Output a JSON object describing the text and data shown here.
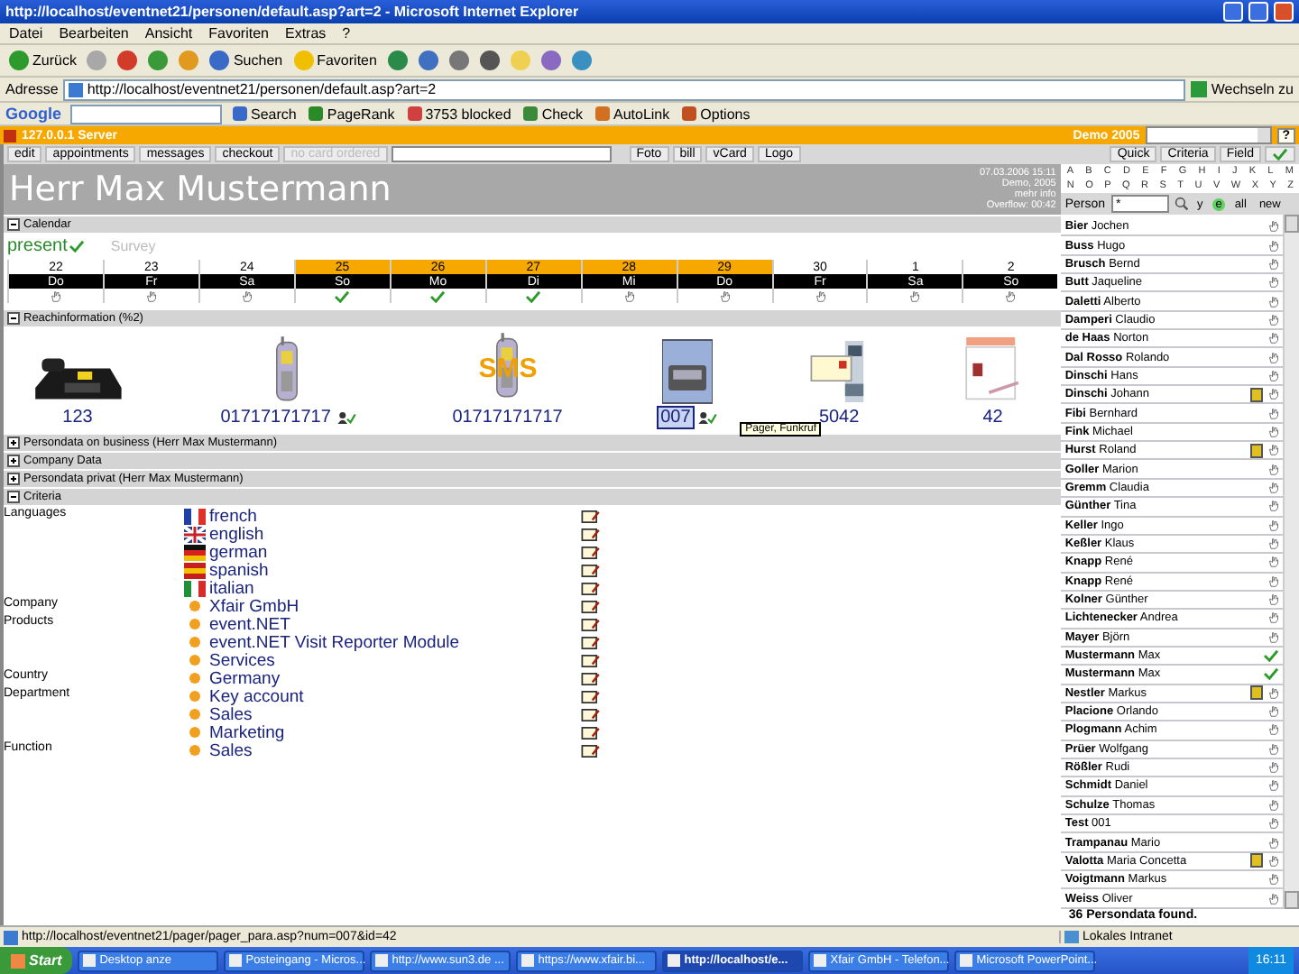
{
  "browser": {
    "title": "http://localhost/eventnet21/personen/default.asp?art=2 - Microsoft Internet Explorer",
    "menu": [
      "Datei",
      "Bearbeiten",
      "Ansicht",
      "Favoriten",
      "Extras",
      "?"
    ],
    "toolbar": [
      {
        "kind": "back",
        "label": "Zurück"
      },
      {
        "kind": "forward"
      },
      {
        "kind": "stop"
      },
      {
        "kind": "refresh"
      },
      {
        "kind": "home"
      },
      {
        "kind": "search",
        "label": "Suchen"
      },
      {
        "kind": "favorites",
        "label": "Favoriten"
      },
      {
        "kind": "history"
      },
      {
        "kind": "mail"
      },
      {
        "kind": "print"
      },
      {
        "kind": "edit"
      },
      {
        "kind": "folder"
      },
      {
        "kind": "research"
      },
      {
        "kind": "messenger"
      }
    ],
    "address": {
      "label": "Adresse",
      "value": "http://localhost/eventnet21/personen/default.asp?art=2",
      "go": "Wechseln zu"
    },
    "google": {
      "logo": "Google",
      "buttons": [
        {
          "kind": "search",
          "label": "Search"
        },
        {
          "kind": "pagerank",
          "label": "PageRank"
        },
        {
          "kind": "blocked",
          "label": "3753 blocked"
        },
        {
          "kind": "check",
          "label": "Check"
        },
        {
          "kind": "autolink",
          "label": "AutoLink"
        },
        {
          "kind": "options",
          "label": "Options"
        }
      ]
    }
  },
  "app": {
    "server": "127.0.0.1 Server",
    "demo": "Demo 2005",
    "help": "?",
    "toolbar": [
      {
        "kind": "button",
        "label": "edit",
        "disabled": false
      },
      {
        "kind": "button",
        "label": "appointments",
        "disabled": false
      },
      {
        "kind": "button",
        "label": "messages",
        "disabled": false
      },
      {
        "kind": "button",
        "label": "checkout",
        "disabled": false
      },
      {
        "kind": "button",
        "label": "no card ordered",
        "disabled": true
      },
      {
        "kind": "input"
      },
      {
        "kind": "button",
        "label": "Foto",
        "disabled": false
      },
      {
        "kind": "button",
        "label": "bill",
        "disabled": false
      },
      {
        "kind": "button",
        "label": "vCard",
        "disabled": false
      },
      {
        "kind": "button",
        "label": "Logo",
        "disabled": false
      }
    ],
    "name": "Herr Max Mustermann",
    "info": [
      "07.03.2006 15:11",
      "Demo, 2005",
      "mehr info",
      "Overflow: 00:42"
    ],
    "sections": [
      {
        "kind": "calendar",
        "title": "Calendar",
        "expanded": true,
        "present": "present",
        "survey": "Survey",
        "days": [
          {
            "date": "22",
            "weekday": "Do",
            "highlighted": false,
            "present": false
          },
          {
            "date": "23",
            "weekday": "Fr",
            "highlighted": false,
            "present": false
          },
          {
            "date": "24",
            "weekday": "Sa",
            "highlighted": false,
            "present": false
          },
          {
            "date": "25",
            "weekday": "So",
            "highlighted": true,
            "present": true
          },
          {
            "date": "26",
            "weekday": "Mo",
            "highlighted": true,
            "present": true
          },
          {
            "date": "27",
            "weekday": "Di",
            "highlighted": true,
            "present": true
          },
          {
            "date": "28",
            "weekday": "Mi",
            "highlighted": true,
            "present": false
          },
          {
            "date": "29",
            "weekday": "Do",
            "highlighted": true,
            "present": false
          },
          {
            "date": "30",
            "weekday": "Fr",
            "highlighted": false,
            "present": false
          },
          {
            "date": "1",
            "weekday": "Sa",
            "highlighted": false,
            "present": false
          },
          {
            "date": "2",
            "weekday": "So",
            "highlighted": false,
            "present": false
          }
        ]
      },
      {
        "kind": "reach",
        "title": "Reachinformation (%2)",
        "expanded": true,
        "items": [
          {
            "kind": "desk_phone",
            "number": "123",
            "selected": false,
            "forward": false
          },
          {
            "kind": "mobile",
            "number": "01717171717",
            "selected": false,
            "forward": true
          },
          {
            "kind": "sms",
            "overlay": "SMS",
            "number": "01717171717",
            "selected": false,
            "forward": false
          },
          {
            "kind": "pager",
            "number": "007",
            "selected": true,
            "forward": true,
            "tooltip": "Pager, Funkruf"
          },
          {
            "kind": "fax",
            "number": "5042",
            "selected": false,
            "forward": false
          },
          {
            "kind": "card",
            "number": "42",
            "selected": false,
            "forward": false
          }
        ]
      },
      {
        "kind": "plain",
        "title": "Persondata on business (Herr Max Mustermann)",
        "expanded": false
      },
      {
        "kind": "plain",
        "title": "Company Data",
        "expanded": false
      },
      {
        "kind": "plain",
        "title": "Persondata privat (Herr Max Mustermann)",
        "expanded": false
      },
      {
        "kind": "criteria",
        "title": "Criteria",
        "expanded": true,
        "groups": [
          {
            "label": "Languages",
            "items": [
              {
                "kind": "french_flag",
                "text": "french"
              },
              {
                "kind": "british_flag",
                "text": "english"
              },
              {
                "kind": "german_flag",
                "text": "german"
              },
              {
                "kind": "spanish_flag",
                "text": "spanish"
              },
              {
                "kind": "italian_flag",
                "text": "italian"
              }
            ]
          },
          {
            "label": "Company",
            "items": [
              {
                "kind": "dot",
                "text": "Xfair GmbH"
              }
            ]
          },
          {
            "label": "Products",
            "items": [
              {
                "kind": "dot",
                "text": "event.NET"
              },
              {
                "kind": "dot",
                "text": "event.NET Visit Reporter Module"
              },
              {
                "kind": "dot",
                "text": "Services"
              }
            ]
          },
          {
            "label": "Country",
            "items": [
              {
                "kind": "dot",
                "text": "Germany"
              }
            ]
          },
          {
            "label": "Department",
            "items": [
              {
                "kind": "dot",
                "text": "Key account"
              },
              {
                "kind": "dot",
                "text": "Sales"
              },
              {
                "kind": "dot",
                "text": "Marketing"
              }
            ]
          },
          {
            "label": "Function",
            "items": [
              {
                "kind": "dot",
                "text": "Sales"
              }
            ]
          }
        ]
      }
    ],
    "panel": {
      "tabs": [
        "Quick",
        "Criteria",
        "Field"
      ],
      "alphabet": [
        [
          "A",
          "B",
          "C",
          "D",
          "E",
          "F",
          "G",
          "H",
          "I",
          "J",
          "K",
          "L",
          "M"
        ],
        [
          "N",
          "O",
          "P",
          "Q",
          "R",
          "S",
          "T",
          "U",
          "V",
          "W",
          "X",
          "Y",
          "Z"
        ]
      ],
      "person_label": "Person",
      "person_value": "*",
      "filters": [
        {
          "label": "y",
          "selected": false
        },
        {
          "label": "e",
          "selected": true
        },
        {
          "label": "all",
          "selected": false
        },
        {
          "label": "new",
          "selected": false
        }
      ],
      "persons": [
        {
          "name": "**Bier** Jochen",
          "note": false,
          "present": false
        },
        {
          "name": "**Buss** Hugo",
          "note": false,
          "present": false
        },
        {
          "name": "**Brusch** Bernd",
          "note": false,
          "present": false
        },
        {
          "name": "**Butt** Jaqueline",
          "note": false,
          "present": false
        },
        {
          "name": "**Daletti** Alberto",
          "note": false,
          "present": false
        },
        {
          "name": "**Damperi** Claudio",
          "note": false,
          "present": false
        },
        {
          "name": "**de Haas** Norton",
          "note": false,
          "present": false
        },
        {
          "name": "**Dal Rosso** Rolando",
          "note": false,
          "present": false
        },
        {
          "name": "**Dinschi** Hans",
          "note": false,
          "present": false
        },
        {
          "name": "**Dinschi** Johann",
          "note": true,
          "present": false
        },
        {
          "name": "**Fibi** Bernhard",
          "note": false,
          "present": false
        },
        {
          "name": "**Fink** Michael",
          "note": false,
          "present": false
        },
        {
          "name": "**Hurst** Roland",
          "note": true,
          "present": false
        },
        {
          "name": "**Goller** Marion",
          "note": false,
          "present": false
        },
        {
          "name": "**Gremm** Claudia",
          "note": false,
          "present": false
        },
        {
          "name": "**Günther** Tina",
          "note": false,
          "present": false
        },
        {
          "name": "**Keller** Ingo",
          "note": false,
          "present": false
        },
        {
          "name": "**Keßler** Klaus",
          "note": false,
          "present": false
        },
        {
          "name": "**Knapp** René",
          "note": false,
          "present": false
        },
        {
          "name": "**Knapp** René",
          "note": false,
          "present": false
        },
        {
          "name": "**Kolner** Günther",
          "note": false,
          "present": false
        },
        {
          "name": "**Lichtenecker** Andrea",
          "note": false,
          "present": false
        },
        {
          "name": "**Mayer** Björn",
          "note": false,
          "present": false
        },
        {
          "name": "**Mustermann** Max",
          "note": false,
          "present": true
        },
        {
          "name": "**Mustermann** Max",
          "note": false,
          "present": true
        },
        {
          "name": "**Nestler** Markus",
          "note": true,
          "present": false
        },
        {
          "name": "**Placione** Orlando",
          "note": false,
          "present": false
        },
        {
          "name": "**Plogmann** Achim",
          "note": false,
          "present": false
        },
        {
          "name": "**Prüer** Wolfgang",
          "note": false,
          "present": false
        },
        {
          "name": "**Rößler** Rudi",
          "note": false,
          "present": false
        },
        {
          "name": "**Schmidt** Daniel",
          "note": false,
          "present": false
        },
        {
          "name": "**Schulze** Thomas",
          "note": false,
          "present": false
        },
        {
          "name": "**Test** 001",
          "note": false,
          "present": false
        },
        {
          "name": "**Trampanau** Mario",
          "note": false,
          "present": false
        },
        {
          "name": "**Valotta** Maria Concetta",
          "note": true,
          "present": false
        },
        {
          "name": "**Voigtmann** Markus",
          "note": false,
          "present": false
        },
        {
          "name": "**Weiss** Oliver",
          "note": false,
          "present": false
        }
      ],
      "found": "36 Persondata found."
    }
  },
  "status_bar": {
    "url": "http://localhost/eventnet21/pager/pager_para.asp?num=007&id=42",
    "zone": "Lokales Intranet"
  },
  "taskbar": {
    "start": "Start",
    "items": [
      {
        "label": "Desktop anze",
        "selected": false
      },
      {
        "label": "Posteingang - Micros...",
        "selected": false
      },
      {
        "label": "http://www.sun3.de ...",
        "selected": false
      },
      {
        "label": "https://www.xfair.bi...",
        "selected": false
      },
      {
        "label": "http://localhost/e...",
        "selected": true
      },
      {
        "label": "Xfair GmbH - Telefon...",
        "selected": false
      },
      {
        "label": "Microsoft PowerPoint...",
        "selected": false
      }
    ],
    "clock": "16:11"
  }
}
